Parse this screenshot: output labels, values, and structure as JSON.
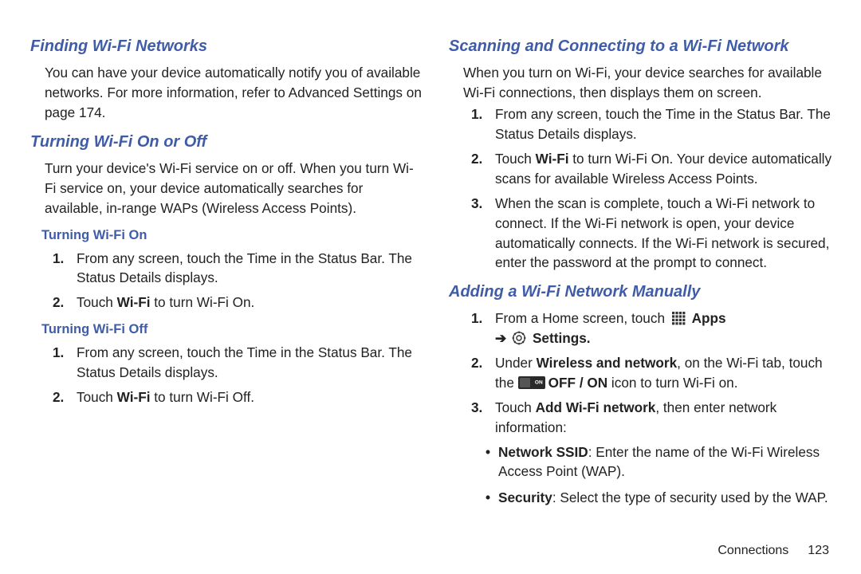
{
  "left": {
    "h_finding": "Finding Wi-Fi Networks",
    "p_finding_a": "You can have your device automatically notify you of available networks. For more information, refer to ",
    "p_finding_link": "Advanced Settings",
    "p_finding_b": " on page 174.",
    "h_turning": "Turning Wi-Fi On or Off",
    "p_turning": "Turn your device's Wi-Fi service on or off. When you turn Wi-Fi service on, your device automatically searches for available, in-range WAPs (Wireless Access Points).",
    "h_on": "Turning Wi-Fi On",
    "on_steps": {
      "s1": "From any screen, touch the Time in the Status Bar. The Status Details displays.",
      "s2a": "Touch ",
      "s2b": "Wi-Fi",
      "s2c": " to turn Wi-Fi On."
    },
    "h_off": "Turning Wi-Fi Off",
    "off_steps": {
      "s1": "From any screen, touch the Time in the Status Bar. The Status Details displays.",
      "s2a": "Touch ",
      "s2b": "Wi-Fi",
      "s2c": " to turn Wi-Fi Off."
    }
  },
  "right": {
    "h_scan": "Scanning and Connecting to a Wi-Fi Network",
    "p_scan": "When you turn on Wi-Fi, your device searches for available Wi-Fi connections, then displays them on screen.",
    "scan_steps": {
      "s1": "From any screen, touch the Time in the Status Bar. The Status Details displays.",
      "s2a": "Touch ",
      "s2b": "Wi-Fi",
      "s2c": " to turn Wi-Fi On. Your device automatically scans for available Wireless Access Points.",
      "s3": "When the scan is complete, touch a Wi-Fi network to connect. If the Wi-Fi network is open, your device automatically connects. If the Wi-Fi network is secured, enter the password at the prompt to connect."
    },
    "h_add": "Adding a Wi-Fi Network Manually",
    "add_steps": {
      "s1a": "From a Home screen, touch ",
      "s1_apps": "Apps",
      "s1_arrow": "➔",
      "s1_settings": "Settings.",
      "s2a": "Under ",
      "s2b": "Wireless and network",
      "s2c": ", on the Wi-Fi tab, touch the ",
      "s2d": "OFF / ON",
      "s2e": " icon to turn Wi-Fi on.",
      "s3a": "Touch ",
      "s3b": "Add Wi-Fi network",
      "s3c": ", then enter network information:"
    },
    "bullets": {
      "b1a": "Network SSID",
      "b1b": ": Enter the name of the Wi-Fi Wireless Access Point (WAP).",
      "b2a": "Security",
      "b2b": ": Select the type of security used by the WAP."
    }
  },
  "footer": {
    "section": "Connections",
    "page": "123"
  }
}
